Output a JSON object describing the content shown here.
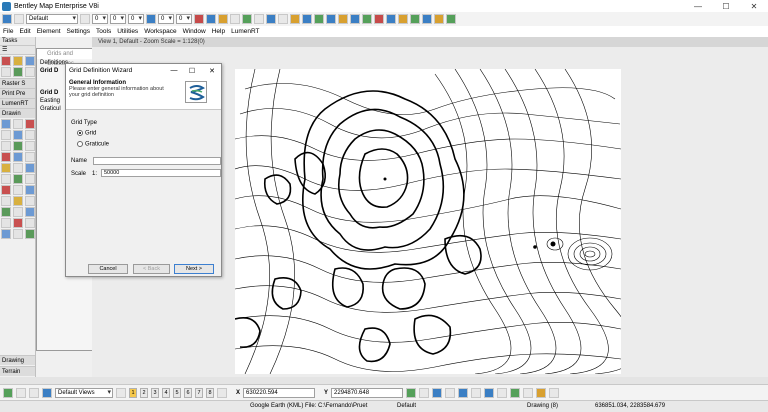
{
  "app": {
    "title": "Bentley Map Enterprise V8i",
    "level_combo": "Default",
    "num0a": "0",
    "num0b": "0",
    "num0c": "0",
    "num0d": "0",
    "num0e": "0"
  },
  "menu": [
    "File",
    "Edit",
    "Element",
    "Settings",
    "Tools",
    "Utilities",
    "Workspace",
    "Window",
    "Help",
    "LumenRT"
  ],
  "tasks_panel": {
    "title": "Tasks",
    "raster": "Raster S",
    "print": "Print Pre",
    "lumen": "LumenRT",
    "drawing": "Drawin",
    "drawing_bottom": "Drawing",
    "terrain": "Terrain"
  },
  "view": {
    "label": "View 1, Default - Zoom Scale = 1:128(0)"
  },
  "grids_dialog": {
    "title": "Grids and Graticules",
    "definitions": "Definitions",
    "item1": "Grid D",
    "item2": "Grid D",
    "easting": "Easting",
    "graticule": "Graticul"
  },
  "wizard": {
    "title": "Grid Definition Wizard",
    "heading": "General Information",
    "subheading": "Please enter general information about your grid definition",
    "grid_type_label": "Grid Type",
    "opt_grid": "Grid",
    "opt_graticule": "Graticule",
    "name_label": "Name",
    "name_value": "",
    "scale_label": "Scale",
    "scale_prefix": "1:",
    "scale_value": "50000",
    "cancel": "Cancel",
    "back": "< Back",
    "next": "Next >",
    "selected_type": "Grid"
  },
  "bottom": {
    "views": "Default Views",
    "x_label": "X",
    "x_value": "630220.594",
    "y_label": "Y",
    "y_value": "2294870.648",
    "view_buttons": [
      "1",
      "2",
      "3",
      "4",
      "5",
      "6",
      "7",
      "8"
    ]
  },
  "status": {
    "file": "Google Earth (KML) File: C:\\Fernando\\Pruet",
    "level": "Default",
    "drawing": "Drawing (8)",
    "coords": "636851.034, 2283584.679"
  }
}
